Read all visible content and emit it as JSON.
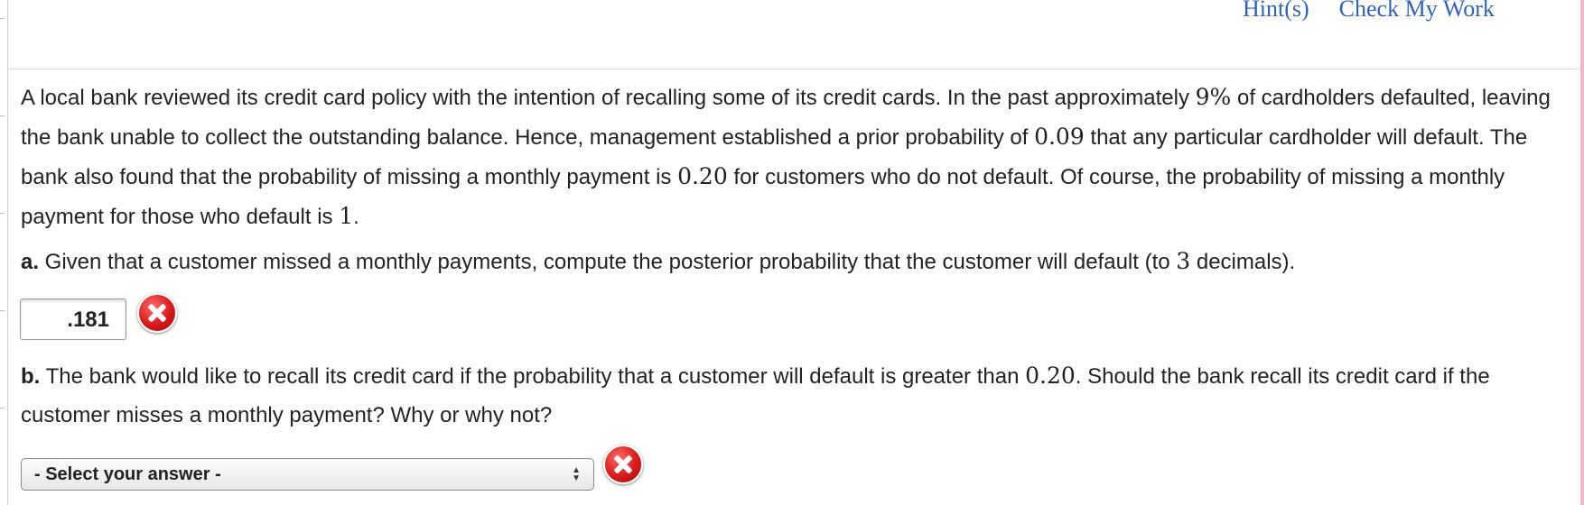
{
  "header": {
    "hint_label": "Hint(s)",
    "check_label": "Check My Work"
  },
  "problem": {
    "s1": "A local bank reviewed its credit card policy with the intention of recalling some of its credit cards. In the past approximately ",
    "v1": "9%",
    "s2": " of cardholders defaulted, leaving the bank unable to collect the outstanding balance. Hence, management established a prior probability of ",
    "v2": "0.09",
    "s3": " that any particular cardholder will default. The bank also found that the probability of missing a monthly payment is ",
    "v3": "0.20",
    "s4": " for customers who do not default. Of course, the probability of missing a monthly payment for those who default is ",
    "v4": "1",
    "s5": "."
  },
  "part_a": {
    "label": "a.",
    "text": " Given that a customer missed a monthly payments, compute the posterior probability that the customer will default (to ",
    "num": "3",
    "text_end": " decimals).",
    "answer_value": ".181",
    "status_icon": "incorrect-x-icon"
  },
  "part_b": {
    "label": "b.",
    "text": " The bank would like to recall its credit card if the probability that a customer will default is greater than ",
    "num": "0.20",
    "text_end": ". Should the bank recall its credit card if the customer misses a monthly payment? Why or why not?",
    "select_value": "- Select your answer -",
    "status_icon": "incorrect-x-icon"
  },
  "colors": {
    "link": "#2f63b8",
    "error": "#d71a1a",
    "edge_accent": "#f3b5c9"
  }
}
